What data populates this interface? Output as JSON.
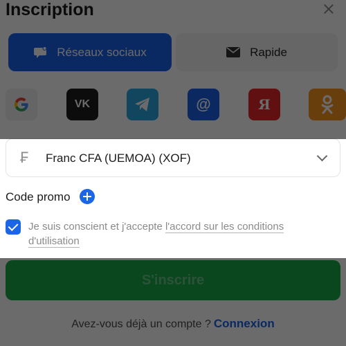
{
  "header": {
    "title": "Inscription"
  },
  "tabs": [
    {
      "label": "Réseaux sociaux",
      "icon": "chat-bubble-icon",
      "active": true
    },
    {
      "label": "Rapide",
      "icon": "envelope-icon",
      "active": false
    }
  ],
  "social": [
    {
      "name": "google",
      "glyph": "G"
    },
    {
      "name": "vk",
      "glyph": "VK"
    },
    {
      "name": "telegram",
      "glyph": "➤"
    },
    {
      "name": "mail",
      "glyph": "@"
    },
    {
      "name": "yandex",
      "glyph": "Я"
    },
    {
      "name": "odnoklassniki",
      "glyph": "OK"
    }
  ],
  "currency": {
    "symbol": "₣",
    "value": "Franc CFA (UEMOA) (XOF)"
  },
  "promo": {
    "label": "Code promo"
  },
  "consent": {
    "text": "Je suis conscient et j'accepte ",
    "link": "l'accord sur les conditions d'utilisation",
    "checked": true
  },
  "submit": {
    "label": "S'inscrire"
  },
  "footer": {
    "question": "Avez-vous déjà un compte ?",
    "login": "Connexion"
  },
  "colors": {
    "accent": "#1a5fe6",
    "submit": "#18a94a"
  }
}
